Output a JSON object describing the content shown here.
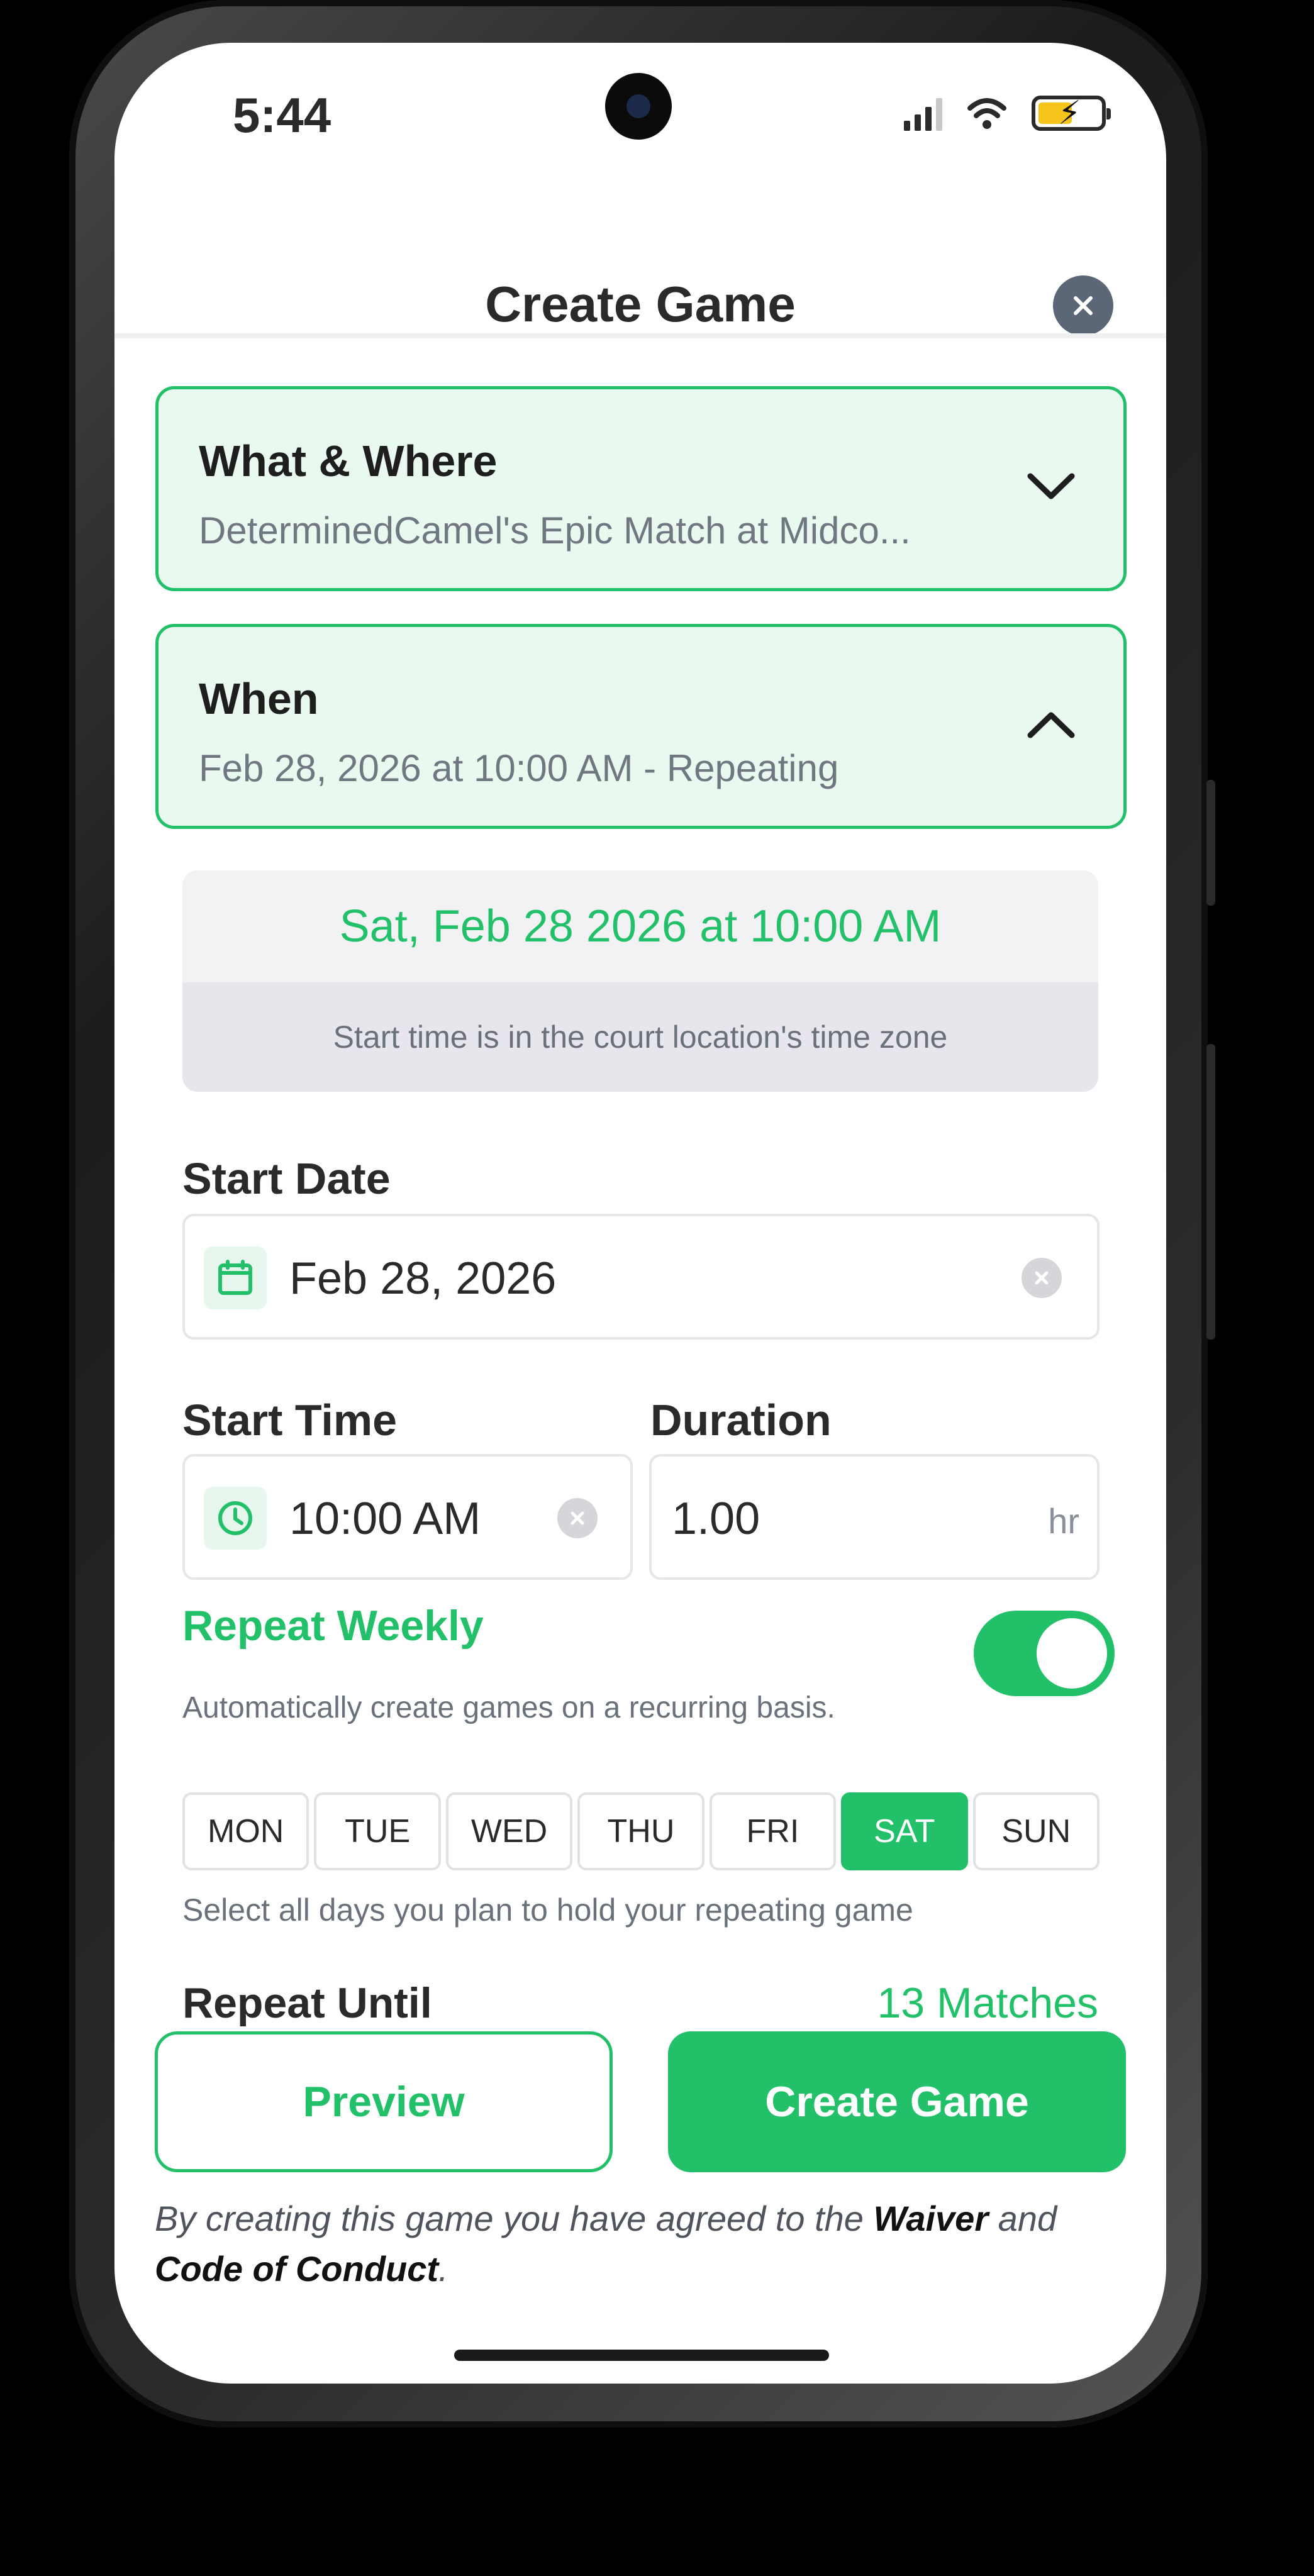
{
  "status_bar": {
    "time": "5:44"
  },
  "header": {
    "title": "Create Game"
  },
  "what_where": {
    "title": "What & Where",
    "subtitle": "DeterminedCamel's Epic Match at Midco...",
    "expanded": false
  },
  "when": {
    "title": "When",
    "subtitle": "Feb 28, 2026 at 10:00 AM  - Repeating",
    "expanded": true
  },
  "datetime_summary": {
    "display": "Sat, Feb 28 2026 at 10:00 AM",
    "note": "Start time is in the court location's time zone"
  },
  "start_date": {
    "label": "Start Date",
    "value": "Feb 28, 2026"
  },
  "start_time": {
    "label": "Start Time",
    "value": "10:00 AM"
  },
  "duration": {
    "label": "Duration",
    "value": "1.00",
    "unit": "hr"
  },
  "repeat": {
    "title": "Repeat Weekly",
    "description": "Automatically create games on a recurring basis.",
    "enabled": true,
    "days": [
      "MON",
      "TUE",
      "WED",
      "THU",
      "FRI",
      "SAT",
      "SUN"
    ],
    "selected_day": "SAT",
    "hint": "Select all days you plan to hold your repeating game",
    "until_label": "Repeat Until",
    "matches": "13 Matches"
  },
  "actions": {
    "preview": "Preview",
    "create": "Create Game"
  },
  "agreement": {
    "prefix": "By creating this game you have agreed to the ",
    "waiver": "Waiver",
    "and": " and",
    "conduct": "Code of Conduct",
    "suffix": "."
  },
  "colors": {
    "accent": "#22c068",
    "card_bg": "#eaf9f0",
    "close_btn": "#5b6677"
  },
  "icons": {
    "close": "close-icon",
    "chevron_down": "chevron-down-icon",
    "chevron_up": "chevron-up-icon",
    "calendar": "calendar-icon",
    "clock": "clock-icon",
    "clear": "clear-icon"
  }
}
